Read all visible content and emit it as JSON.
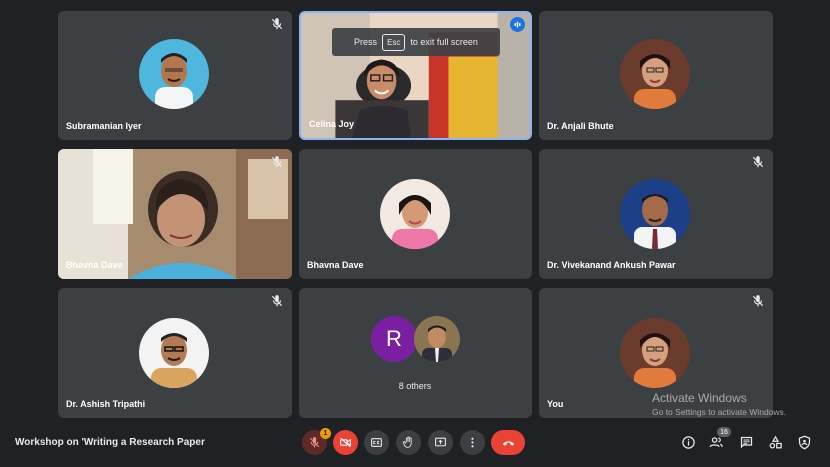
{
  "toast": {
    "press": "Press",
    "key": "Esc",
    "rest": "to exit full screen"
  },
  "participants": [
    {
      "name": "Subramanian Iyer"
    },
    {
      "name": "Celina Joy"
    },
    {
      "name": "Dr. Anjali Bhute"
    },
    {
      "name": "Bhavna Dave"
    },
    {
      "name": "Bhavna Dave"
    },
    {
      "name": "Dr. Vivekanand Ankush Pawar"
    },
    {
      "name": "Dr. Ashish Tripathi"
    },
    {
      "name": "You"
    }
  ],
  "others": {
    "initial": "R",
    "label": "8 others"
  },
  "meeting": {
    "title": "Workshop on 'Writing a Research Paper"
  },
  "controls": {
    "notification_count": "1",
    "participants_count": "16"
  },
  "watermark": {
    "line1": "Activate Windows",
    "line2": "Go to Settings to activate Windows."
  },
  "colors": {
    "background": "#202124",
    "tile": "#3c4043",
    "end_call": "#ea4335",
    "accent": "#1a73e8",
    "speaking_border": "#8ab4f8"
  }
}
